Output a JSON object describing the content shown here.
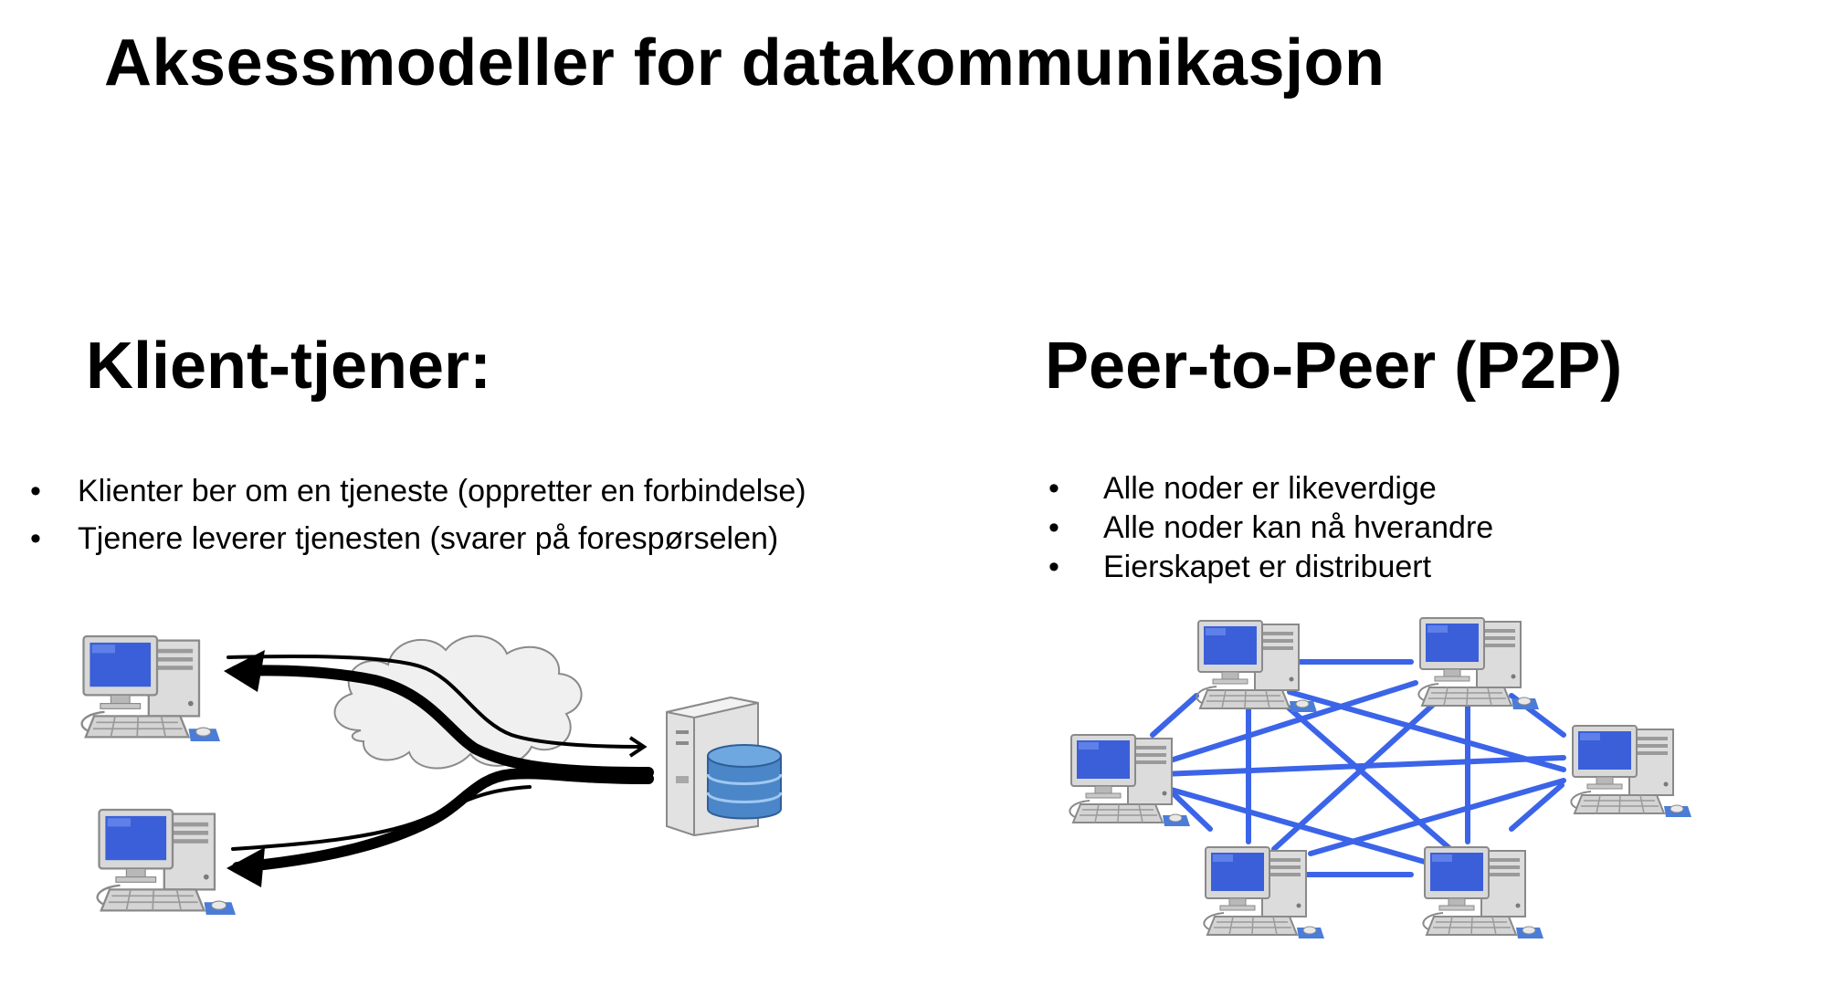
{
  "title": "Aksessmodeller for datakommunikasjon",
  "client_server": {
    "heading": "Klient-tjener:",
    "bullets": [
      "Klienter ber om en tjeneste (oppretter en forbindelse)",
      "Tjenere leverer tjenesten (svarer på forespørselen)"
    ],
    "icons": [
      "computer-icon",
      "computer-icon",
      "cloud-icon",
      "server-icon",
      "database-icon"
    ]
  },
  "p2p": {
    "heading": "Peer-to-Peer (P2P)",
    "bullets": [
      "Alle noder er likeverdige",
      "Alle noder kan nå hverandre",
      "Eierskapet er distribuert"
    ],
    "node_count": 6,
    "link_color": "#3b64e8"
  },
  "colors": {
    "screen_blue": "#3a5fd8",
    "arrow": "#000000",
    "cloud_fill": "#f0f0f0",
    "db_blue": "#4a86c8"
  }
}
